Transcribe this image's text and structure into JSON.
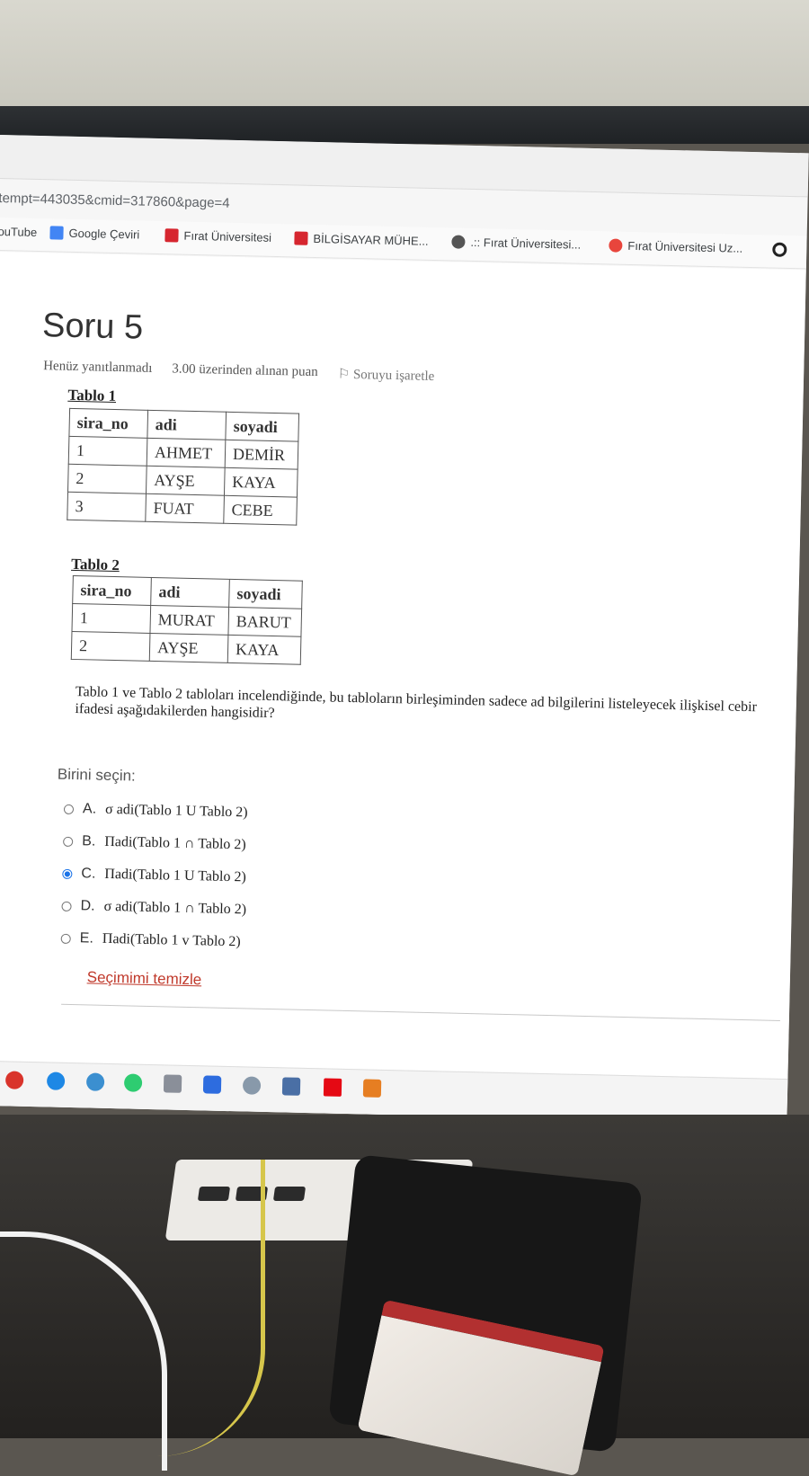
{
  "browser": {
    "url_fragment": "tempt=443035&cmid=317860&page=4",
    "bookmarks": [
      {
        "label": "ouTube",
        "icon": ""
      },
      {
        "label": "Google Çeviri",
        "icon": "google-translate-icon"
      },
      {
        "label": "Fırat Üniversitesi",
        "icon": "firat-logo-icon"
      },
      {
        "label": "BİLGİSAYAR MÜHE...",
        "icon": "firat-logo-icon"
      },
      {
        "label": ".:: Fırat Üniversitesi...",
        "icon": "globe-icon"
      },
      {
        "label": "Fırat Üniversitesi Uz...",
        "icon": "red-circle-icon"
      },
      {
        "label": "",
        "icon": "github-icon"
      }
    ]
  },
  "question": {
    "title": "Soru 5",
    "status": "Henüz yanıtlanmadı",
    "grade": "3.00 üzerinden alınan puan",
    "flag_label": "Soruyu işaretle",
    "text": "Tablo 1 ve Tablo 2 tabloları incelendiğinde, bu tabloların birleşiminden sadece ad bilgilerini listeleyecek ilişkisel cebir ifadesi aşağıdakilerden hangisidir?",
    "choose_label": "Birini seçin:",
    "clear_label": "Seçimimi temizle",
    "options": [
      {
        "letter": "A.",
        "text": "σ adi(Tablo 1 U Tablo 2)",
        "selected": false
      },
      {
        "letter": "B.",
        "text": "Πadi(Tablo 1 ∩ Tablo 2)",
        "selected": false
      },
      {
        "letter": "C.",
        "text": "Πadi(Tablo 1 U Tablo 2)",
        "selected": true
      },
      {
        "letter": "D.",
        "text": "σ adi(Tablo 1 ∩ Tablo 2)",
        "selected": false
      },
      {
        "letter": "E.",
        "text": "Πadi(Tablo 1 v Tablo 2)",
        "selected": false
      }
    ]
  },
  "tables": [
    {
      "caption": "Tablo 1",
      "headers": [
        "sira_no",
        "adi",
        "soyadi"
      ],
      "rows": [
        [
          "1",
          "AHMET",
          "DEMİR"
        ],
        [
          "2",
          "AYŞE",
          "KAYA"
        ],
        [
          "3",
          "FUAT",
          "CEBE"
        ]
      ]
    },
    {
      "caption": "Tablo 2",
      "headers": [
        "sira_no",
        "adi",
        "soyadi"
      ],
      "rows": [
        [
          "1",
          "MURAT",
          "BARUT"
        ],
        [
          "2",
          "AYŞE",
          "KAYA"
        ]
      ]
    }
  ],
  "colors": {
    "link": "#c0392b",
    "radio_selected": "#1a73e8"
  }
}
